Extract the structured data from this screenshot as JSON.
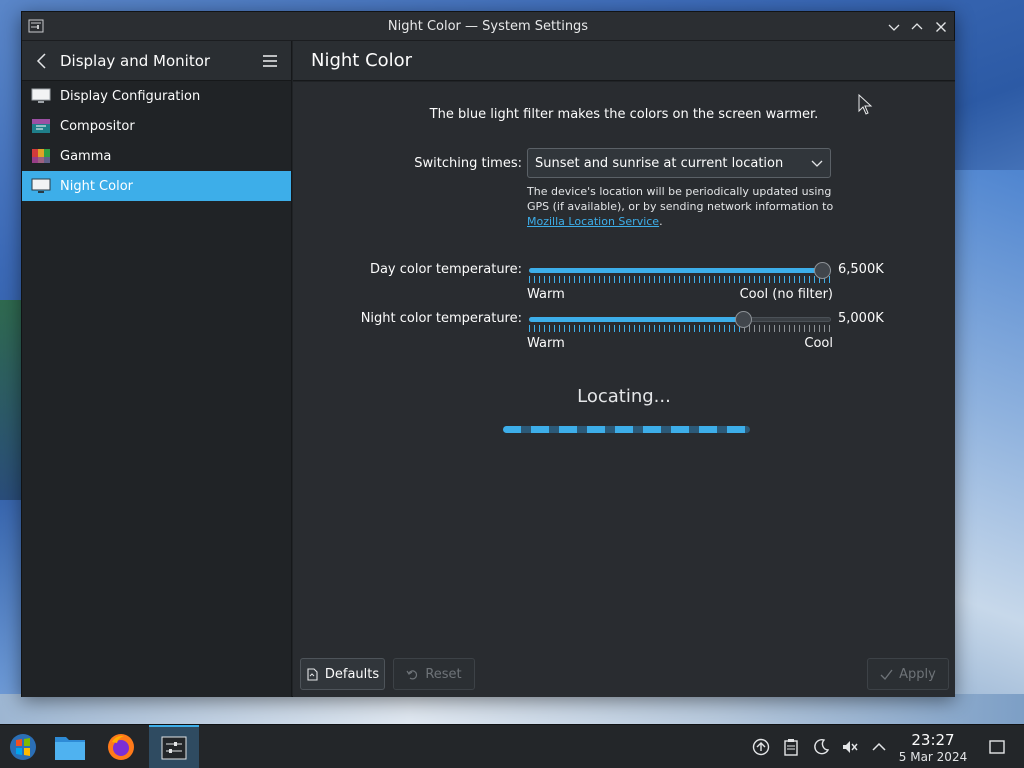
{
  "window": {
    "title": "Night Color — System Settings"
  },
  "sidebar": {
    "header": "Display and Monitor",
    "items": [
      {
        "label": "Display Configuration",
        "icon": "monitor-icon",
        "active": false
      },
      {
        "label": "Compositor",
        "icon": "compositor-icon",
        "active": false
      },
      {
        "label": "Gamma",
        "icon": "gamma-icon",
        "active": false
      },
      {
        "label": "Night Color",
        "icon": "night-color-icon",
        "active": true
      }
    ]
  },
  "content": {
    "title": "Night Color",
    "description": "The blue light filter makes the colors on the screen warmer.",
    "switching": {
      "label": "Switching times:",
      "value": "Sunset and sunrise at current location",
      "help_prefix": "The device's location will be periodically updated using GPS (if available), or by sending network information to ",
      "help_link": "Mozilla Location Service",
      "help_suffix": "."
    },
    "day": {
      "label": "Day color temperature:",
      "value": "6,500K",
      "position_fraction": 1.0,
      "left_label": "Warm",
      "right_label": "Cool (no filter)"
    },
    "night": {
      "label": "Night color temperature:",
      "value": "5,000K",
      "position_fraction": 0.71,
      "left_label": "Warm",
      "right_label": "Cool"
    },
    "status": "Locating..."
  },
  "footer": {
    "defaults": "Defaults",
    "reset": "Reset",
    "apply": "Apply"
  },
  "taskbar": {
    "time": "23:27",
    "date": "5 Mar 2024"
  },
  "colors": {
    "accent": "#3daee9",
    "window_bg": "#202326",
    "panel_bg": "#292c30"
  }
}
